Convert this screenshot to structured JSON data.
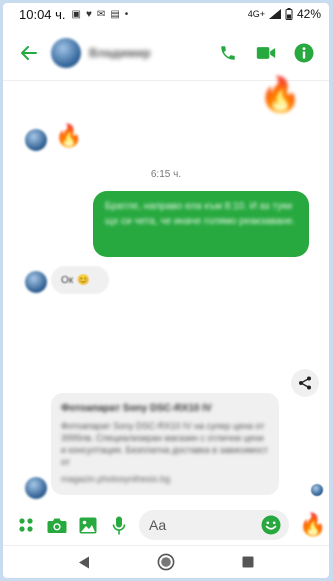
{
  "status": {
    "time": "10:04 ч.",
    "network": "4G+",
    "battery": "42%"
  },
  "header": {
    "contact_name": "Владимир"
  },
  "chat": {
    "timestamp": "6:15 ч.",
    "outgoing_text": "Братле, направо ела към 8:10. И аз туки щх си чета, че иначе голямо реакзаване.",
    "incoming_text": "Ок",
    "link_title": "Фотоапарат Sony DSC-RX10 IV",
    "link_description": "Фотоапарат Sony DSC-RX10 IV на супер цена от 3999лв. Специализиран магазин с отлични цени и консултация. Безплатна доставка в зависимост от",
    "link_url": "magazin.photosynthesis.bg"
  },
  "composer": {
    "placeholder": "Aa"
  },
  "colors": {
    "accent": "#27a93f",
    "incoming_bubble": "#f0f0f0"
  },
  "icons": {
    "back": "arrow-left-icon",
    "call": "phone-icon",
    "video": "video-camera-icon",
    "info": "info-icon",
    "share": "share-icon",
    "apps": "four-dots-icon",
    "camera": "camera-icon",
    "gallery": "image-icon",
    "mic": "microphone-icon",
    "emoji": "smiley-icon"
  }
}
